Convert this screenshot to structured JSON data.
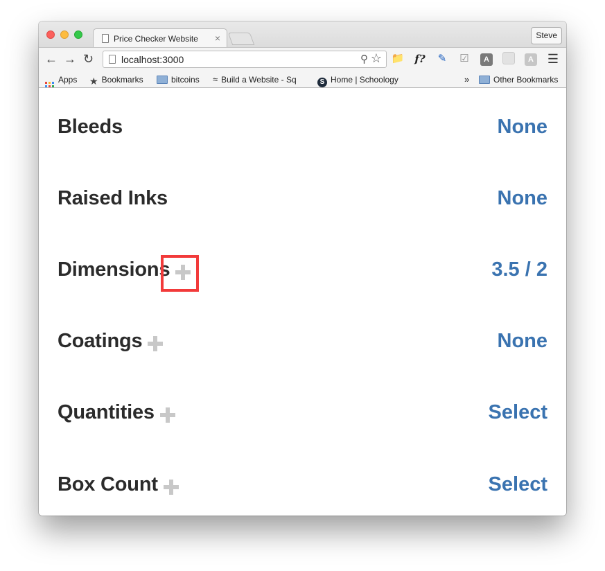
{
  "browser": {
    "tab_title": "Price Checker Website",
    "tab_close": "×",
    "profile_name": "Steve",
    "url": "localhost:3000",
    "extensions": [
      "folder-icon",
      "formula-icon",
      "note-icon",
      "checklist-icon",
      "angular-icon",
      "blank-icon",
      "angular-light-icon",
      "menu-icon"
    ]
  },
  "bookmarks": {
    "apps": "Apps",
    "items": [
      "Bookmarks",
      "bitcoins",
      "Build a Website - Sq",
      "Home | Schoology"
    ],
    "overflow": "»",
    "other": "Other Bookmarks"
  },
  "page": {
    "rows": [
      {
        "label": "Bleeds",
        "value": "None",
        "has_plus": false
      },
      {
        "label": "Raised Inks",
        "value": "None",
        "has_plus": false
      },
      {
        "label": "Dimensions",
        "value": "3.5 / 2",
        "has_plus": true,
        "highlighted": true
      },
      {
        "label": "Coatings",
        "value": "None",
        "has_plus": true
      },
      {
        "label": "Quantities",
        "value": "Select",
        "has_plus": true
      },
      {
        "label": "Box Count",
        "value": "Select",
        "has_plus": true
      }
    ]
  },
  "colors": {
    "label": "#2b2b2b",
    "value": "#3a73b0",
    "plus": "#c8c8c8",
    "highlight": "#f23a3a"
  }
}
